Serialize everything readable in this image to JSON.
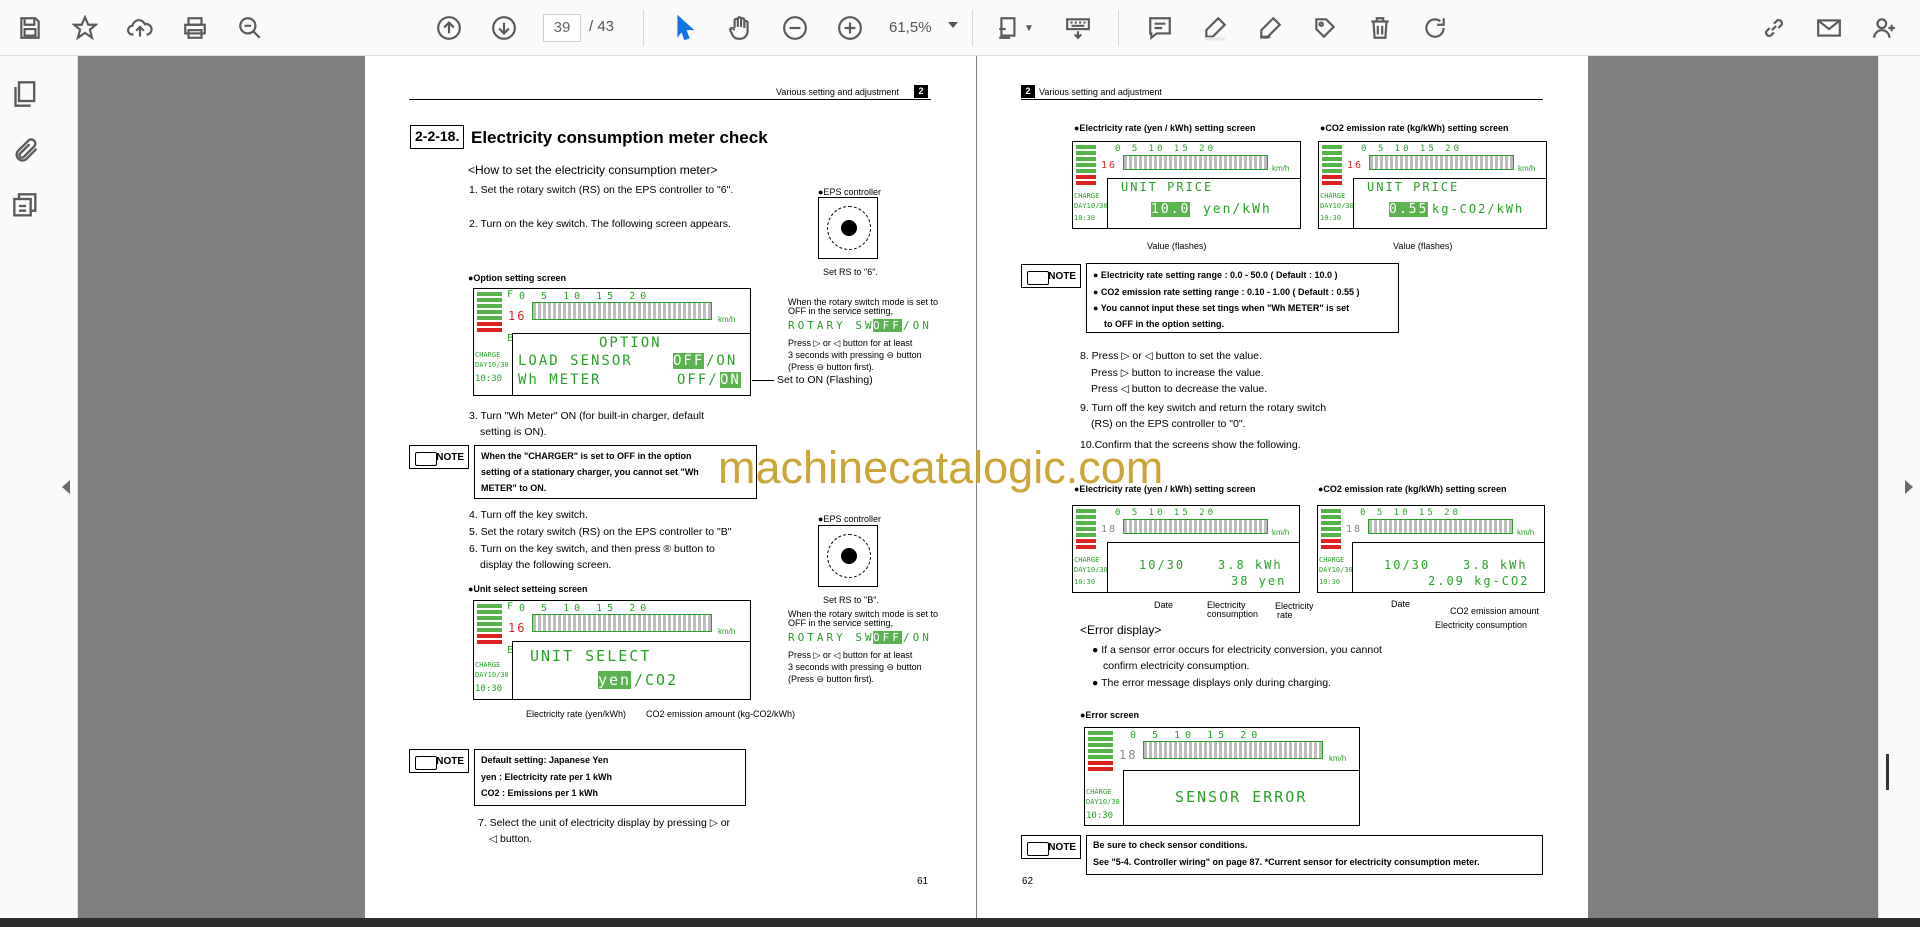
{
  "toolbar": {
    "page_current": "39",
    "page_total": "/ 43",
    "zoom": "61,5%",
    "icons": [
      "save-icon",
      "star-icon",
      "upload-icon",
      "print-icon",
      "zoom-search-icon",
      "page-up-icon",
      "page-down-icon",
      "select-cursor-icon",
      "hand-icon",
      "zoom-out-icon",
      "zoom-in-icon",
      "fit-page-icon",
      "keyboard-icon",
      "comment-icon",
      "highlight-pen-icon",
      "draw-icon",
      "stamp-icon",
      "delete-icon",
      "redo-icon",
      "link-icon",
      "mail-icon",
      "add-user-icon"
    ]
  },
  "watermark": "machinecatalogic.com",
  "left_page": {
    "header": "Various setting and adjustment",
    "chapter": "2",
    "section_num": "2-2-18.",
    "section_title": "Electricity consumption meter check",
    "subheading": "<How to set the electricity consumption meter>",
    "step1": "1. Set the rotary switch (RS) on the EPS controller to \"6\".",
    "step2": "2. Turn on the key switch. The following screen appears.",
    "eps_controller": "●EPS controller",
    "set_rs6": "Set RS to \"6\".",
    "option_screen_label": "●Option setting screen",
    "rotary_note1": "When the rotary switch mode is set to",
    "rotary_note2": "OFF in the service setting,",
    "rotary_sw_text": "ROTARY SW",
    "off_on_off": "OFF",
    "off_on_on": "/ON",
    "press1": "Press ▷ or ◁ button for at least",
    "press2": "3 seconds with pressing ⊖ button",
    "press3": "(Press ⊖ button first).",
    "lcd_option_1": "OPTION",
    "lcd_option_2": "LOAD SENSOR",
    "lcd_option_2b": "OFF",
    "lcd_option_2c": "/ON",
    "lcd_option_3": "Wh METER",
    "lcd_option_3b": "OFF/",
    "lcd_option_3c": "ON",
    "set_on_flashing": "Set to ON (Flashing)",
    "step3a": "3. Turn  \"Wh Meter\" ON (for built-in charger, default",
    "step3b": "setting is ON).",
    "note_text1": "When the \"CHARGER\" is set to OFF in the option",
    "note_text2": "setting of a stationary charger, you cannot set \"Wh",
    "note_text3": "METER\" to ON.",
    "note_label": "NOTE",
    "step4": "4. Turn off the key switch.",
    "step5": "5. Set the rotary switch (RS) on the EPS controller to \"B\"",
    "step6a": "6. Turn on the key switch, and then press ® button to",
    "step6b": "display the following screen.",
    "set_rsb": "Set RS to \"B\".",
    "unit_screen_label": "●Unit select setteing screen",
    "lcd_unit_1": "UNIT SELECT",
    "lcd_unit_2a": "yen",
    "lcd_unit_2b": "/CO2",
    "cap_rate": "Electricity rate (yen/kWh)",
    "cap_co2": "CO2 emission amount (kg-CO2/kWh)",
    "default1": "Default setting: Japanese Yen",
    "default2": "yen     : Electricity rate per 1 kWh",
    "default3": "CO2     : Emissions per 1 kWh",
    "step7a": "7. Select the unit of electricity display by pressing ▷ or",
    "step7b": "◁ button.",
    "page_number": "61"
  },
  "right_page": {
    "header": "Various setting and adjustment",
    "chapter": "2",
    "elec_rate_screen": "●Electricity rate (yen / kWh) setting screen",
    "co2_rate_screen": "●CO2 emission rate (kg/kWh) setting screen",
    "unit_price": "UNIT PRICE",
    "val_yen": "10.0",
    "unit_yen": "yen/kWh",
    "val_co2": "0.55",
    "unit_co2": "kg-CO2/kWh",
    "value_flashes": "Value (flashes)",
    "note1": "●  Electricity rate setting range : 0.0 - 50.0 ( Default : 10.0 )",
    "note2": "●  CO2 emission rate setting range : 0.10 - 1.00 ( Default : 0.55 )",
    "note3": "●  You cannot input these set tings when \"Wh METER\" is set",
    "note4": "to OFF in the option setting.",
    "note_label": "NOTE",
    "step8a": "8. Press ▷ or ◁ button to set the value.",
    "step8b": "Press ▷ button to increase the value.",
    "step8c": "Press ◁ button to decrease the value.",
    "step9a": "9. Turn off the key switch and return the rotary switch",
    "step9b": "(RS) on the EPS controller to \"0\".",
    "step10": "10.Confirm that the screens show the following.",
    "lcd_date": "10/30",
    "lcd_kwh": "3.8 kWh",
    "lcd_yen": "38 yen",
    "lcd_co2v": "2.09 kg-CO2",
    "cap_date": "Date",
    "cap_elec1": "Electricity",
    "cap_elec2": "consumption",
    "cap_rate1": "Electricity",
    "cap_rate2": "rate",
    "cap_co2amt": "CO2 emission amount",
    "cap_elecc": "Electricity consumption",
    "error_display": "<Error display>",
    "err1a": "●  If a sensor error occurs for electricity conversion, you cannot",
    "err1b": "confirm electricity consumption.",
    "err2": "●  The error message displays only during charging.",
    "error_screen": "●Error screen",
    "sensor_error": "SENSOR ERROR",
    "note_b1": "Be sure to check sensor conditions.",
    "note_b2": "See \"5-4. Controller wiring\" on page 87. *Current sensor for electricity consumption meter.",
    "page_number": "62"
  },
  "lcd_common": {
    "scale": "0  5 10 15 20",
    "kmh": "km/h",
    "charge": "CHARGE",
    "day": "DAY10/30",
    "time": "10:30",
    "f": "F",
    "e": "E",
    "speed16": "16",
    "speed18": "18"
  }
}
